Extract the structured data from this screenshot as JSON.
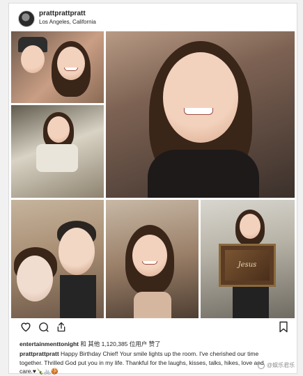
{
  "post": {
    "username": "prattprattpratt",
    "location": "Los Angeles, California"
  },
  "likes": {
    "account": "entertainmenttonight",
    "text": " 和 其他 1,120,385 位用户 赞了"
  },
  "caption": {
    "username": "prattprattpratt",
    "line1": " Happy Birthday Chief! Your smile lights up the room. I've cherished our time",
    "line2": "together. Thrilled God put you in my life. Thankful for the laughs, kisses, talks, hikes, love and",
    "line3": "care.♥🍾🚲🍪"
  },
  "plaque": {
    "text": "Jesus"
  },
  "watermark": {
    "text": "@娱乐君乐"
  },
  "icons": [
    "heart-icon",
    "comment-icon",
    "share-icon",
    "bookmark-icon"
  ],
  "colors": {
    "text": "#262626",
    "border": "#dbdbdb",
    "background": "#f1f1f1"
  }
}
